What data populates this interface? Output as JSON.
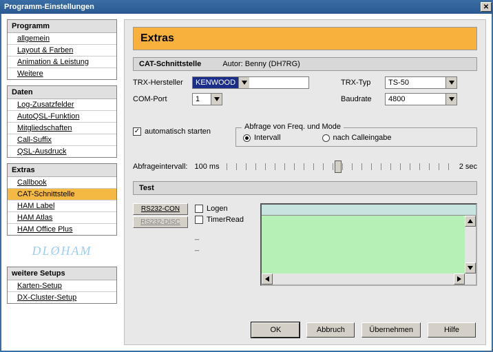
{
  "window": {
    "title": "Programm-Einstellungen"
  },
  "sidebar": {
    "groups": [
      {
        "title": "Programm",
        "items": [
          "allgemein",
          "Layout & Farben",
          "Animation & Leistung",
          "Weitere"
        ]
      },
      {
        "title": "Daten",
        "items": [
          "Log-Zusatzfelder",
          "AutoQSL-Funktion",
          "Mitgliedschaften",
          "Call-Suffix",
          "QSL-Ausdruck"
        ]
      },
      {
        "title": "Extras",
        "items": [
          "Callbook",
          "CAT-Schnittstelle",
          "HAM Label",
          "HAM Atlas",
          "HAM Office Plus"
        ],
        "selected_index": 1
      },
      {
        "title": "weitere Setups",
        "items": [
          "Karten-Setup",
          "DX-Cluster-Setup"
        ]
      }
    ],
    "brand": "DLØHAM"
  },
  "page": {
    "title": "Extras",
    "cat": {
      "header_label": "CAT-Schnittstelle",
      "author_label": "Autor: Benny (DH7RG)",
      "trx_hersteller_label": "TRX-Hersteller",
      "trx_hersteller_value": "KENWOOD",
      "trx_typ_label": "TRX-Typ",
      "trx_typ_value": "TS-50",
      "com_port_label": "COM-Port",
      "com_port_value": "1",
      "baud_label": "Baudrate",
      "baud_value": "4800",
      "autostart_label": "automatisch starten",
      "autostart_checked": true,
      "abfrage_group": "Abfrage von Freq. und Mode",
      "abfrage_intervall": "Intervall",
      "abfrage_calleingabe": "nach Calleingabe",
      "abfrage_selected": "intervall",
      "intervall_label": "Abfrageintervall:",
      "intervall_min": "100 ms",
      "intervall_max": "2 sec"
    },
    "test": {
      "header": "Test",
      "rs_con": "RS232-CON",
      "rs_disc": "RS232-DISC",
      "logen": "Logen",
      "timerread": "TimerRead",
      "dash1": "_",
      "dash2": "_"
    },
    "buttons": {
      "ok": "OK",
      "abbruch": "Abbruch",
      "uebernehmen": "Übernehmen",
      "hilfe": "Hilfe"
    }
  }
}
